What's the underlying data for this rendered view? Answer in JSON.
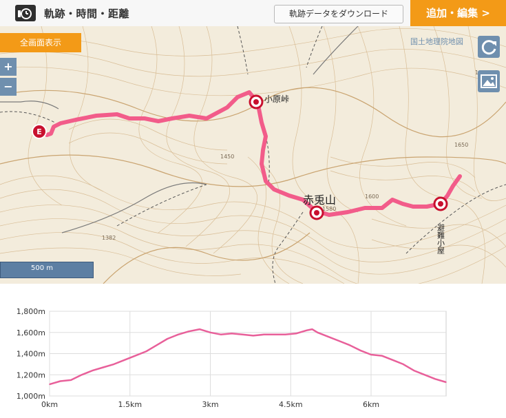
{
  "header": {
    "icon": "clock-icon",
    "title": "軌跡・時間・距離",
    "download_label": "軌跡データをダウンロード",
    "edit_label": "追加・編集 >"
  },
  "map": {
    "fullscreen_label": "全画面表示",
    "zoom_in_label": "+",
    "zoom_out_label": "−",
    "attribution": "国土地理院地図",
    "refresh_icon": "refresh-icon",
    "photo_icon": "photo-icon",
    "scale_label": "500 m",
    "places": [
      {
        "name": "小原峠"
      },
      {
        "name": "赤兎山"
      },
      {
        "name": "避難小屋"
      }
    ],
    "end_marker_label": "E",
    "elevation_labels": [
      "1382",
      "1450",
      "1580",
      "1600",
      "1650",
      "1800"
    ],
    "track_color": "#f25c8a",
    "marker_color": "#c8102e"
  },
  "chart_data": {
    "type": "line",
    "title": "",
    "xlabel": "",
    "ylabel": "",
    "xlim": [
      0,
      7.4
    ],
    "ylim": [
      1000,
      1800
    ],
    "x_ticks": [
      "0km",
      "1.5km",
      "3km",
      "4.5km",
      "6km"
    ],
    "y_ticks": [
      "1,000m",
      "1,200m",
      "1,400m",
      "1,600m",
      "1,800m"
    ],
    "grid": true,
    "color": "#e8609a",
    "x": [
      0,
      0.2,
      0.4,
      0.6,
      0.8,
      1.0,
      1.2,
      1.4,
      1.6,
      1.8,
      2.0,
      2.2,
      2.4,
      2.6,
      2.8,
      3.0,
      3.2,
      3.4,
      3.6,
      3.8,
      4.0,
      4.2,
      4.4,
      4.6,
      4.8,
      4.9,
      5.0,
      5.2,
      5.4,
      5.6,
      5.8,
      6.0,
      6.2,
      6.4,
      6.6,
      6.8,
      7.0,
      7.2,
      7.4
    ],
    "y": [
      1110,
      1140,
      1150,
      1200,
      1240,
      1270,
      1300,
      1340,
      1380,
      1420,
      1480,
      1540,
      1580,
      1610,
      1630,
      1600,
      1580,
      1590,
      1580,
      1570,
      1580,
      1580,
      1580,
      1590,
      1620,
      1630,
      1600,
      1560,
      1520,
      1480,
      1430,
      1390,
      1380,
      1340,
      1300,
      1240,
      1200,
      1160,
      1130
    ]
  }
}
